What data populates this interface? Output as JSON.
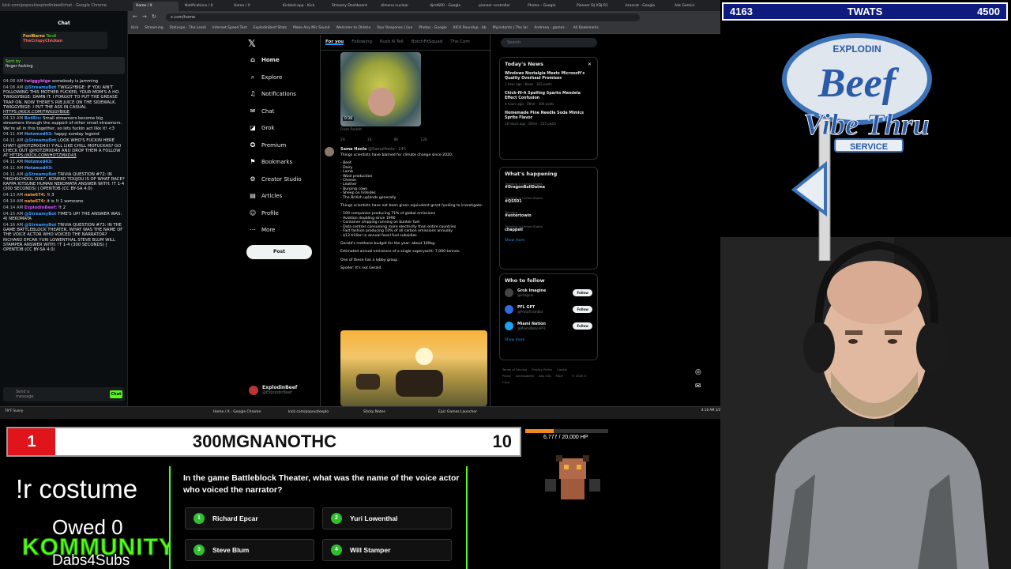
{
  "chat": {
    "url": "kick.com/popout/explodinbeef/chat - Google Chrome",
    "title": "Chat",
    "pinned": {
      "user1": "FoolBarnz",
      "user2": "TheCrispyChicken",
      "tag": "Tandi"
    },
    "sent_by": "Sent by",
    "sent_text": "finger fucking",
    "messages": [
      {
        "time": "04:08 AM",
        "user": "twiggybige",
        "cls": "u-twig",
        "text": "somebody is jamming"
      },
      {
        "time": "04:08 AM",
        "user": "@StreamyBot",
        "cls": "u-bot",
        "text": "TWIGGYBIGE: IF YOU AIN'T FOLLOWING THIS MOTHER FUCKER, YOUR MOM'S A HO. TWIGGYBIGE: DAMN IT. I FORGOT TO PUT THE GREASE TRAP ON. NOW THERE'S RIB JUICE ON THE SIDEWALK. TWIGGYBIGE: I PUT THE ASS IN CASUAL",
        "link": "HTTPS://KICK.COM/TWIGGYBIGE"
      },
      {
        "time": "04:10 AM",
        "user": "BotRix:",
        "cls": "u-bot",
        "text": "Small streamers become big streamers through the support of other small streamers. We're all in this together, so lets fuckin act like it! <3"
      },
      {
        "time": "04:11 AM",
        "user": "Hotzmxd43:",
        "cls": "u-hot",
        "text": "happy sunday legend"
      },
      {
        "time": "04:11 AM",
        "user": "@StreamyBot",
        "cls": "u-bot",
        "text": "LOOK WHO'S FUCKIN HERE CHAT! @HOTZMXD43! Y'ALL LIKE CHILL MOFUCKAS? GO CHECK OUT @HOTZMXD43 AND DROP THEM A FOLLOW AT",
        "link": "HTTPS://KICK.COM/HOTZMXD43"
      },
      {
        "time": "04:11 AM",
        "user": "Hotzmxd43:",
        "cls": "u-hot",
        "text": ""
      },
      {
        "time": "04:11 AM",
        "user": "Hotzmxd43:",
        "cls": "u-hot",
        "text": ""
      },
      {
        "time": "04:11 AM",
        "user": "@StreamyBot",
        "cls": "u-bot",
        "text": "TRIVIA QUESTION #72: IN \"HIGHSCHOOL DXD\", KONEKO TOUJOU IS OF WHAT RACE? KAPPA KITSUNE HUMAN NEKOMATA ANSWER WITH: !T 1-4 (300 SECONDS) | OPENTDB (CC BY-SA 4.0)"
      },
      {
        "time": "04:13 AM",
        "user": "nate674:",
        "cls": "u-nate",
        "text": "!t 3"
      },
      {
        "time": "04:14 AM",
        "user": "nate674:",
        "cls": "u-nate",
        "text": "it is !t 1 someone"
      },
      {
        "time": "04:14 AM",
        "user": "ExplodinBeef:",
        "cls": "u-exp",
        "text": "!t 2"
      },
      {
        "time": "04:15 AM",
        "user": "@StreamyBot",
        "cls": "u-bot",
        "text": "TIME'S UP! THE ANSWER WAS: 4) NEKOMATA"
      },
      {
        "time": "04:16 AM",
        "user": "@StreamyBot",
        "cls": "u-bot",
        "text": "TRIVIA QUESTION #73: IN THE GAME BATTLEBLOCK THEATER, WHAT WAS THE NAME OF THE VOICE ACTOR WHO VOICED THE NARRATOR? RICHARD EPCAR YURI LOWENTHAL STEVE BLUM WILL STAMPER ANSWER WITH: !T 1-4 (300 SECONDS) | OPENTDB (CC BY-SA 4.0)"
      }
    ],
    "input_placeholder": "Send a message",
    "send_label": "Chat"
  },
  "browser": {
    "tabs": [
      "Home / X",
      "Notifications / X",
      "Home / X",
      "Kickbot.app - Kick",
      "Streamy Dashboard",
      "dimona nuclear",
      "djmt600 - Google",
      "pioneer controller",
      "Photos - Google",
      "Pioneer DJ XDJ-R1",
      "brascat - Google",
      "Ask Gemini"
    ],
    "url": "x.com/home",
    "bookmarks": [
      "Kick",
      "Streaming",
      "Statuspe - The Leadi",
      "Internet Speed Test",
      "ExplodinBeef Stats",
      "Make Any Mic Sound",
      "Welcome to Oklaho",
      "Your Response | live",
      "Photos - Google",
      "KICK Roundup - bb",
      "Myinstants | The lar",
      "Andreea - games -",
      "All Bookmarks"
    ]
  },
  "x": {
    "nav": [
      {
        "label": "Home",
        "icon": "home-icon",
        "glyph": "⌂"
      },
      {
        "label": "Explore",
        "icon": "search-icon",
        "glyph": "⌕"
      },
      {
        "label": "Notifications",
        "icon": "bell-icon",
        "glyph": "♫"
      },
      {
        "label": "Chat",
        "icon": "mail-icon",
        "glyph": "✉"
      },
      {
        "label": "Grok",
        "icon": "grok-icon",
        "glyph": "◪"
      },
      {
        "label": "Premium",
        "icon": "premium-icon",
        "glyph": "✪"
      },
      {
        "label": "Bookmarks",
        "icon": "bookmark-icon",
        "glyph": "⚑"
      },
      {
        "label": "Creator Studio",
        "icon": "studio-icon",
        "glyph": "⚙"
      },
      {
        "label": "Articles",
        "icon": "articles-icon",
        "glyph": "▤"
      },
      {
        "label": "Profile",
        "icon": "person-icon",
        "glyph": "☺"
      },
      {
        "label": "More",
        "icon": "more-icon",
        "glyph": "⋯"
      }
    ],
    "post_label": "Post",
    "profile_name": "ExplodinBeef",
    "profile_handle": "@ExplodinBeef",
    "feed_tabs": [
      "For you",
      "Following",
      "Kush N Tell",
      "BotchFitSquad",
      "The Com"
    ],
    "img1_time": "0:38",
    "img1_source": "From Reddit",
    "tweet1_actions": [
      "29",
      "1K",
      "8K",
      "12K"
    ],
    "tweet2": {
      "name": "Sama Hoole",
      "meta": "@SamaHoole · 14h",
      "intro": "Things scientists have blamed for climate change since 2020:",
      "list1": [
        "- Beef",
        "- Dairy",
        "- Lamb",
        "- Wool production",
        "- Cheese",
        "- Leather",
        "- Burping cows",
        "- Sheep on hillsides",
        "- The British uplands generally"
      ],
      "intro2": "Things scientists have not been given equivalent grant funding to investigate:",
      "list2": [
        "- 100 companies producing 71% of global emissions",
        "- Aviation doubling since 1990",
        "- Container shipping running on bunker fuel",
        "- Data centres consuming more electricity than entire countries",
        "- Fast fashion producing 10% of all carbon emissions annually",
        "- $13 trillion in annual fossil fuel subsidies"
      ],
      "p1": "Gerald's methane budget for the year: about 100kg.",
      "p2": "Estimated annual emissions of a single superyacht: 7,000 tonnes.",
      "p3": "One of these has a lobby group.",
      "p4": "Spoiler: It's not Gerald."
    },
    "search_placeholder": "Search",
    "news_title": "Today's News",
    "news": [
      {
        "title": "Windows Nostalgia Meets Microsoft's Quality Overhaul Promises",
        "meta": "1 hour ago · News · 162 posts"
      },
      {
        "title": "Chick-fil-A Spelling Sparks Mandela Effect Confusion",
        "meta": "4 hours ago · Other · 306 posts"
      },
      {
        "title": "Homemade Pine Needle Soda Mimics Sprite Flavor",
        "meta": "16 hours ago · Other · 555 posts"
      }
    ],
    "happening_title": "What's happening",
    "trends": [
      {
        "context": "Trending in United States",
        "topic": "#DragonBallDaima"
      },
      {
        "context": "Trending in United States",
        "topic": "#QS501"
      },
      {
        "context": "Trending",
        "topic": "#entertowin"
      },
      {
        "context": "Trending in United States",
        "topic": "chappell"
      }
    ],
    "show_more": "Show more",
    "wtf_title": "Who to follow",
    "wtf": [
      {
        "name": "Grok Imagine",
        "handle": "@imagine",
        "color": "#444"
      },
      {
        "name": "PFL GPT",
        "handle": "@ProtoFinishBot",
        "color": "#2d6cdf"
      },
      {
        "name": "Miami Nation",
        "handle": "@MiamiNationPFL",
        "color": "#1da1f2"
      }
    ],
    "follow_label": "Follow",
    "footer": [
      "Terms of Service",
      "Privacy Policy",
      "Cookie Policy",
      "Accessibility",
      "Ads info",
      "More ···",
      "© 2025 X Corp."
    ]
  },
  "taskbar": {
    "weather": "79°F Sunny",
    "items": [
      "Home / X - Google Chrome",
      "kick.com/popout/explo",
      "Sticky Notes",
      "Epic Games Launcher"
    ],
    "clock": "4:18 AM 3/22/2026"
  },
  "topbar": {
    "left": "4163",
    "center": "TWATS",
    "right": "4500"
  },
  "logo": {
    "top": "EXPLODIN",
    "word1": "Beef",
    "word2": "Vibe Thru",
    "word3": "SERVICE"
  },
  "rank": {
    "num": "1",
    "name": "300MGNANOTHC",
    "score": "10"
  },
  "boss": {
    "hp_text": "6,777 / 20,000 HP",
    "hp_fraction": 0.34
  },
  "costume": "!r costume",
  "owed": "Owed 0",
  "kommunity": "KOMMUNITY",
  "dabs": "Dabs4Subs",
  "trivia": {
    "question": "In the game Battleblock Theater, what was the name of the voice actor who voiced the narrator?",
    "answers": [
      {
        "num": "1",
        "text": "Richard Epcar"
      },
      {
        "num": "2",
        "text": "Yuri Lowenthal"
      },
      {
        "num": "3",
        "text": "Steve Blum"
      },
      {
        "num": "4",
        "text": "Will Stamper"
      }
    ]
  },
  "colors": {
    "kick_green": "#53fc18",
    "x_blue": "#1d9bf0",
    "rank_red": "#e0141b",
    "topbar_blue": "#0d1a7e"
  }
}
